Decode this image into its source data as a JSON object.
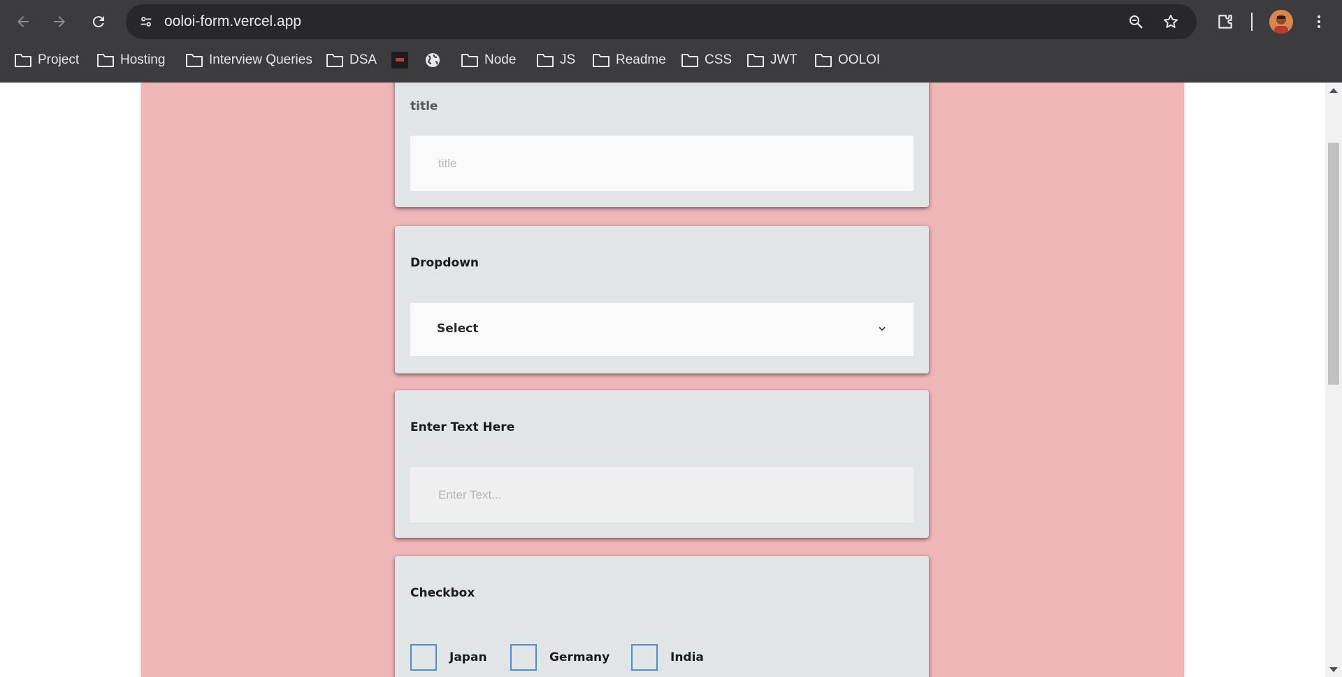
{
  "browser": {
    "url": "ooloi-form.vercel.app",
    "bookmarks": [
      {
        "label": "Project",
        "icon": "folder-icon"
      },
      {
        "label": "Hosting",
        "icon": "folder-icon"
      },
      {
        "label": "Interview Queries",
        "icon": "folder-icon"
      },
      {
        "label": "DSA",
        "icon": "folder-icon"
      },
      {
        "label": "",
        "icon": "site-favicon"
      },
      {
        "label": "",
        "icon": "globe-icon"
      },
      {
        "label": "Node",
        "icon": "folder-icon"
      },
      {
        "label": "JS",
        "icon": "folder-icon"
      },
      {
        "label": "Readme",
        "icon": "folder-icon"
      },
      {
        "label": "CSS",
        "icon": "folder-icon"
      },
      {
        "label": "JWT",
        "icon": "folder-icon"
      },
      {
        "label": "OOLOI",
        "icon": "folder-icon"
      }
    ]
  },
  "form": {
    "title_card": {
      "label": "title",
      "placeholder": "title"
    },
    "dropdown_card": {
      "label": "Dropdown",
      "selected": "Select"
    },
    "text_card": {
      "label": "Enter Text Here",
      "placeholder": "Enter Text..."
    },
    "checkbox_card": {
      "label": "Checkbox",
      "options": [
        "Japan",
        "Germany",
        "India"
      ]
    }
  },
  "colors": {
    "page_background": "#efb6b8",
    "card_background": "#e2e5e6",
    "checkbox_border": "#4a90d9",
    "chrome_background": "#3c3b3e"
  }
}
